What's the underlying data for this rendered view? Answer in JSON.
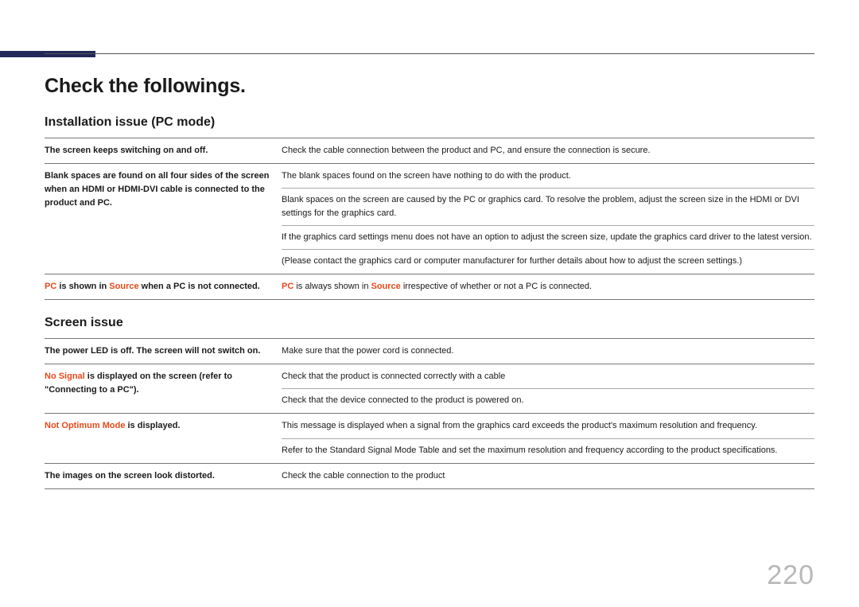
{
  "title": "Check the followings.",
  "pageNumber": "220",
  "sections": [
    {
      "title": "Installation issue (PC mode)",
      "rows": [
        {
          "symptom": [
            {
              "t": "The screen keeps switching on and off."
            }
          ],
          "remedies": [
            [
              {
                "t": "Check the cable connection between the product and PC, and ensure the connection is secure."
              }
            ]
          ]
        },
        {
          "symptom": [
            {
              "t": "Blank spaces are found on all four sides of the screen when an HDMI or HDMI-DVI cable is connected to the product and PC."
            }
          ],
          "remedies": [
            [
              {
                "t": "The blank spaces found on the screen have nothing to do with the product."
              }
            ],
            [
              {
                "t": "Blank spaces on the screen are caused by the PC or graphics card. To resolve the problem, adjust the screen size in the HDMI or DVI settings for the graphics card."
              }
            ],
            [
              {
                "t": "If the graphics card settings menu does not have an option to adjust the screen size, update the graphics card driver to the latest version."
              }
            ],
            [
              {
                "t": "(Please contact the graphics card or computer manufacturer for further details about how to adjust the screen settings.)"
              }
            ]
          ]
        },
        {
          "symptom": [
            {
              "t": "PC",
              "cls": "orangeb"
            },
            {
              "t": " is shown in "
            },
            {
              "t": "Source",
              "cls": "orangeb"
            },
            {
              "t": " when a PC is not connected."
            }
          ],
          "remedies": [
            [
              {
                "t": "PC",
                "cls": "orangeb"
              },
              {
                "t": " is always shown in "
              },
              {
                "t": "Source",
                "cls": "orangeb"
              },
              {
                "t": " irrespective of whether or not a PC is connected."
              }
            ]
          ]
        }
      ]
    },
    {
      "title": "Screen issue",
      "rows": [
        {
          "symptom": [
            {
              "t": "The power LED is off. The screen will not switch on."
            }
          ],
          "remedies": [
            [
              {
                "t": "Make sure that the power cord is connected."
              }
            ]
          ]
        },
        {
          "symptom": [
            {
              "t": "No Signal",
              "cls": "orangeb"
            },
            {
              "t": " is displayed on the screen (refer to \"Connecting to a PC\")."
            }
          ],
          "remedies": [
            [
              {
                "t": "Check that the product is connected correctly with a cable"
              }
            ],
            [
              {
                "t": "Check that the device connected to the product is powered on."
              }
            ]
          ]
        },
        {
          "symptom": [
            {
              "t": "Not Optimum Mode",
              "cls": "orangeb"
            },
            {
              "t": " is displayed."
            }
          ],
          "remedies": [
            [
              {
                "t": "This message is displayed when a signal from the graphics card exceeds the product's maximum resolution and frequency."
              }
            ],
            [
              {
                "t": "Refer to the Standard Signal Mode Table and set the maximum resolution and frequency according to the product specifications."
              }
            ]
          ]
        },
        {
          "symptom": [
            {
              "t": "The images on the screen look distorted."
            }
          ],
          "remedies": [
            [
              {
                "t": "Check the cable connection to the product"
              }
            ]
          ]
        }
      ]
    }
  ]
}
